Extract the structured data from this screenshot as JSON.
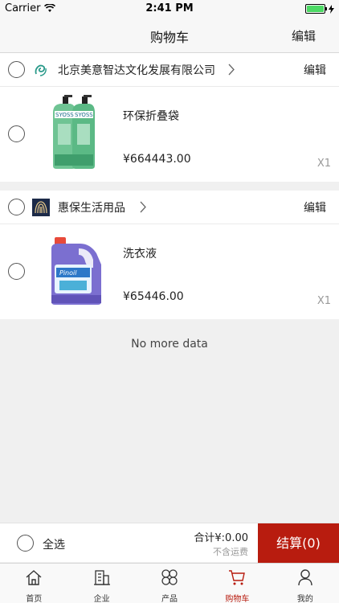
{
  "status_bar": {
    "carrier": "Carrier",
    "time": "2:41 PM"
  },
  "nav": {
    "title": "购物车",
    "edit_label": "编辑"
  },
  "shops": [
    {
      "name": "北京美意智达文化发展有限公司",
      "edit_label": "编辑",
      "logo": "swirl-logo-icon",
      "items": [
        {
          "name": "环保折叠袋",
          "price": "¥664443.00",
          "qty": "X1",
          "image": "shampoo-bottles"
        }
      ]
    },
    {
      "name": "惠保生活用品",
      "edit_label": "编辑",
      "logo": "striped-logo-icon",
      "items": [
        {
          "name": "洗衣液",
          "price": "¥65446.00",
          "qty": "X1",
          "image": "detergent-jug"
        }
      ]
    }
  ],
  "no_more": "No more data",
  "checkout": {
    "select_all": "全选",
    "total": "合计¥:0.00",
    "freight_note": "不含运费",
    "button": "结算(0)"
  },
  "tabs": [
    {
      "label": "首页",
      "icon": "home-icon"
    },
    {
      "label": "企业",
      "icon": "building-icon"
    },
    {
      "label": "产品",
      "icon": "grid-petals-icon"
    },
    {
      "label": "购物车",
      "icon": "cart-icon",
      "active": true
    },
    {
      "label": "我的",
      "icon": "user-icon"
    }
  ],
  "colors": {
    "accent": "#b81c0f",
    "background": "#f0f0f0"
  }
}
